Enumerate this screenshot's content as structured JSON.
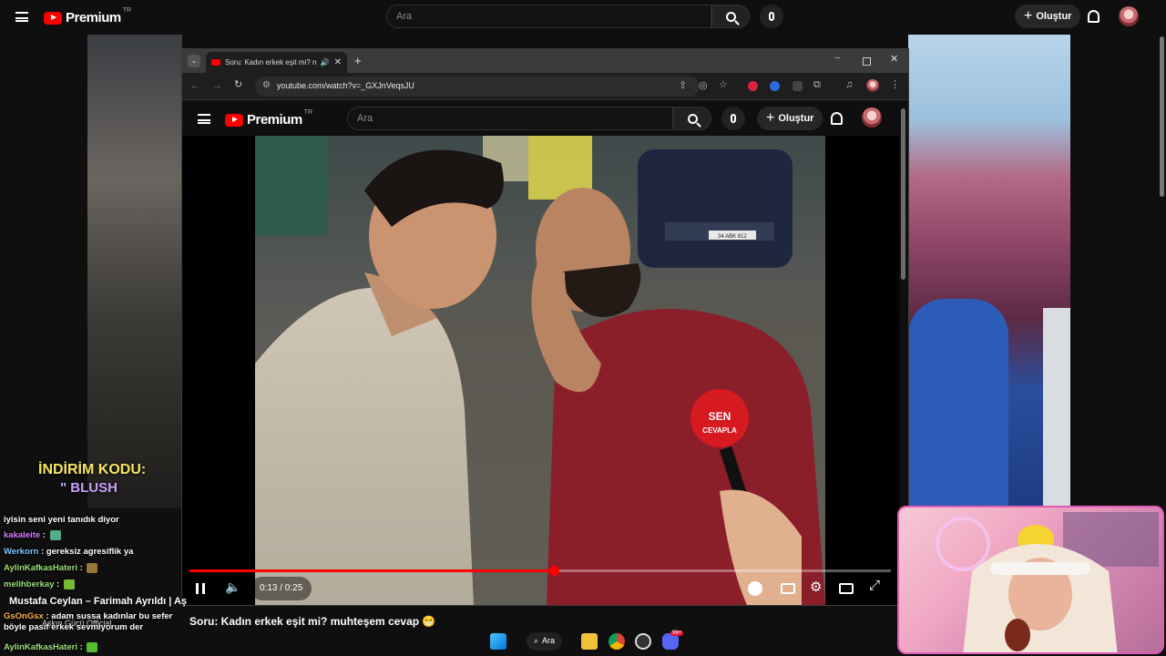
{
  "outer": {
    "logo_text": "Premium",
    "logo_region": "TR",
    "search_placeholder": "Ara",
    "create_label": "Oluştur"
  },
  "browser": {
    "tab_title": "Soru: Kadın erkek eşit mi? m",
    "url": "youtube.com/watch?v=_GXJnVeqsJU"
  },
  "inner": {
    "logo_text": "Premium",
    "logo_region": "TR",
    "search_placeholder": "Ara",
    "create_label": "Oluştur"
  },
  "player": {
    "time": "0:13 / 0:25",
    "progress_fraction": 0.52
  },
  "video": {
    "mic_logo_line1": "SEN",
    "mic_logo_line2": "CEVAPLA",
    "plate": "34 ABK 812"
  },
  "video_title": "Soru: Kadın erkek eşit mi? muhteşem cevap 😁",
  "stream_overlay": {
    "discount_line1": "İNDİRİM KODU:",
    "discount_line2": "\" BLUSH",
    "video_caption": "Mustafa Ceylan – Farimah Ayrıldı | Aş",
    "channel_caption": "Aşkın Gücü Official"
  },
  "chat": [
    {
      "user": "",
      "message": "iyisin seni yeni tanıdık diyor"
    },
    {
      "user": "kakaleite",
      "message": ""
    },
    {
      "user": "Werkorn",
      "message": "gereksiz agresiflik ya"
    },
    {
      "user": "AylinKafkasHateri",
      "message": ""
    },
    {
      "user": "melihberkay",
      "message": ""
    },
    {
      "user": "GsOnGsx",
      "message": "adam sussa kadınlar bu sefer böyle pasif erkek sevmiyorum der"
    },
    {
      "user": "AylinKafkasHateri",
      "message": ""
    }
  ],
  "taskbar": {
    "search_label": "Ara",
    "badge": "99+"
  },
  "colors": {
    "youtube_red": "#ff0000",
    "webcam_border": "#e25bb5",
    "chat_username": "#9ee07d"
  }
}
